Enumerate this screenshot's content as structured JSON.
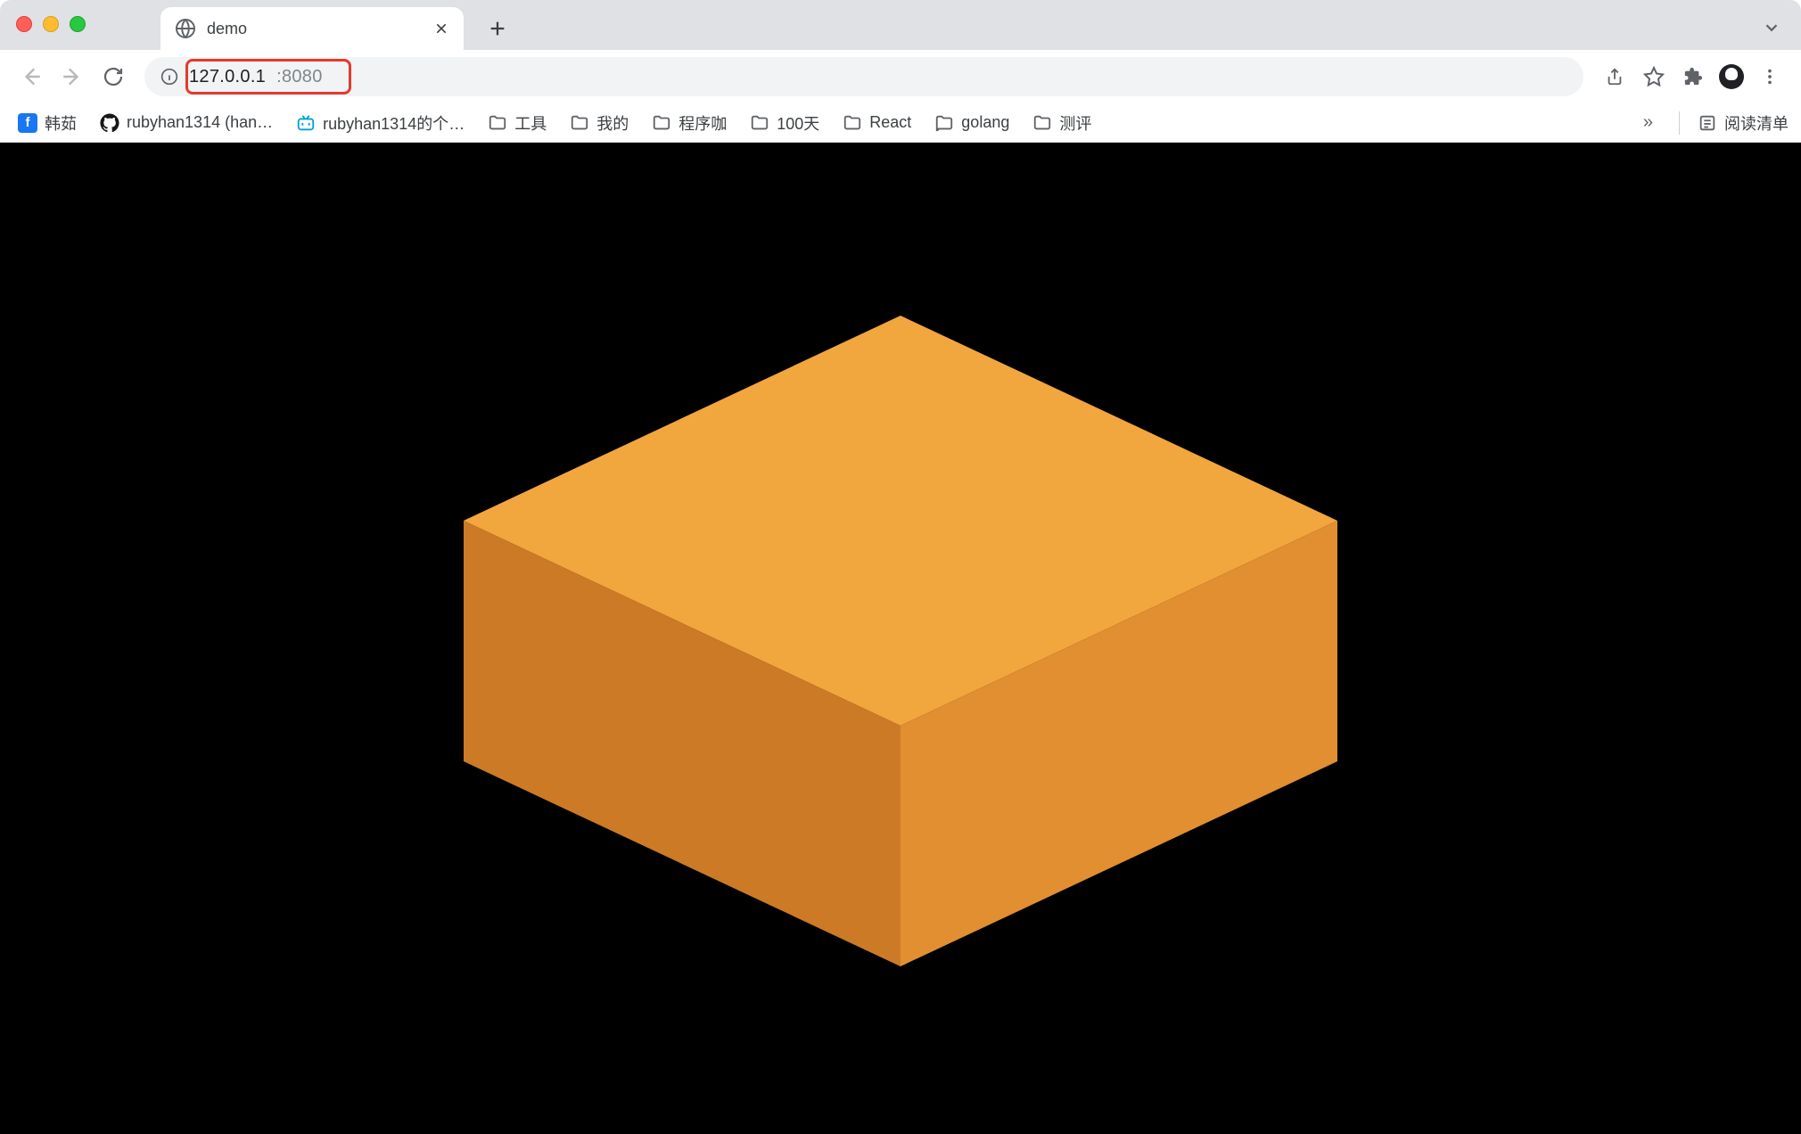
{
  "window": {
    "tabs": [
      {
        "title": "demo",
        "favicon": "globe-icon"
      }
    ]
  },
  "toolbar": {
    "url_host": "127.0.0.1",
    "url_port": ":8080",
    "highlight": true
  },
  "bookmarks": {
    "items": [
      {
        "label": "韩茹",
        "icon": "facebook"
      },
      {
        "label": "rubyhan1314 (han…",
        "icon": "github"
      },
      {
        "label": "rubyhan1314的个…",
        "icon": "bilibili"
      },
      {
        "label": "工具",
        "icon": "folder"
      },
      {
        "label": "我的",
        "icon": "folder"
      },
      {
        "label": "程序咖",
        "icon": "folder"
      },
      {
        "label": "100天",
        "icon": "folder"
      },
      {
        "label": "React",
        "icon": "folder"
      },
      {
        "label": "golang",
        "icon": "folder"
      },
      {
        "label": "测评",
        "icon": "folder"
      }
    ],
    "overflow": "»",
    "reading_list": "阅读清单"
  },
  "scene": {
    "background": "#000000",
    "cube_colors": {
      "top": "#f2a63e",
      "left": "#cc7a26",
      "right": "#e18f30"
    }
  }
}
